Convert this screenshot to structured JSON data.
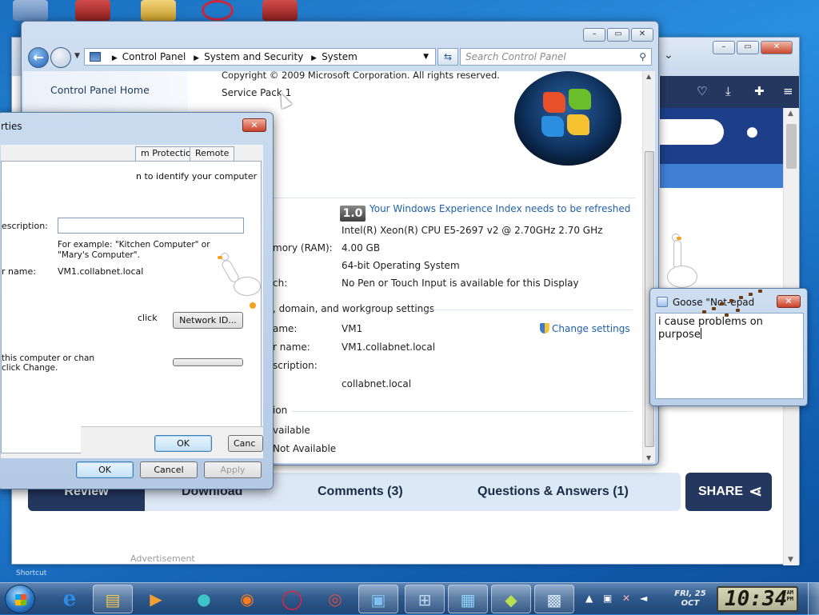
{
  "control_panel": {
    "breadcrumb": [
      "Control Panel",
      "System and Security",
      "System"
    ],
    "search_placeholder": "Search Control Panel",
    "left_pane": {
      "home_link": "Control Panel Home"
    },
    "windows_edition": {
      "copyright": "Copyright © 2009 Microsoft Corporation.  All rights reserved.",
      "service_pack": "Service Pack 1"
    },
    "system": {
      "rating_badge": "1.0",
      "rating_link": "Your Windows Experience Index needs to be refreshed",
      "processor": "Intel(R) Xeon(R) CPU E5-2697 v2 @ 2.70GHz   2.70 GHz",
      "memory_label": "mory (RAM):",
      "memory_value": "4.00 GB",
      "system_type_value": "64-bit Operating System",
      "pen_label": "ch:",
      "pen_value": "No Pen or Touch Input is available for this Display"
    },
    "computer_name": {
      "section_title": ", domain, and workgroup settings",
      "change_settings": "Change settings",
      "name_label": "ame:",
      "name_value": "VM1",
      "full_label": "r name:",
      "full_value": "VM1.collabnet.local",
      "desc_label": "scription:",
      "domain_value": "collabnet.local"
    },
    "activation": {
      "section_title": "ion",
      "line1": "vailable",
      "line2": "Not Available"
    }
  },
  "system_properties": {
    "title": "rties",
    "tabs": [
      "m Protection",
      "Remote"
    ],
    "intro": "n to identify your computer",
    "desc_label": "escription:",
    "example": "For example: \"Kitchen Computer\" or \"Mary's Computer\".",
    "full_name_label": "r name:",
    "full_name_value": "VM1.collabnet.local",
    "network_text": "click",
    "network_button": "Network ID...",
    "rename_text1": "this computer or chan",
    "rename_text2": "click Change.",
    "inner_ok": "OK",
    "inner_cancel": "Canc",
    "ok": "OK",
    "cancel": "Cancel",
    "apply": "Apply"
  },
  "goose_note": {
    "title": "Goose \"Not-epad",
    "text": "i cause problems on purpose"
  },
  "browser_page": {
    "tabs": [
      "Review",
      "Download",
      "Comments (3)",
      "Questions & Answers (1)"
    ],
    "share_label": "SHARE",
    "ad_label": "Advertisement"
  },
  "taskbar": {
    "date_line1": "FRI, 25",
    "date_line2": "OCT",
    "time": "10:34",
    "ampm_top": "AM",
    "ampm_bottom": "PM"
  },
  "desktop": {
    "corner_text": "Shortcut"
  },
  "colors": {
    "accent_dark": "#24375f",
    "link": "#1f5fa8",
    "taskbar": "#2f5a8c"
  }
}
